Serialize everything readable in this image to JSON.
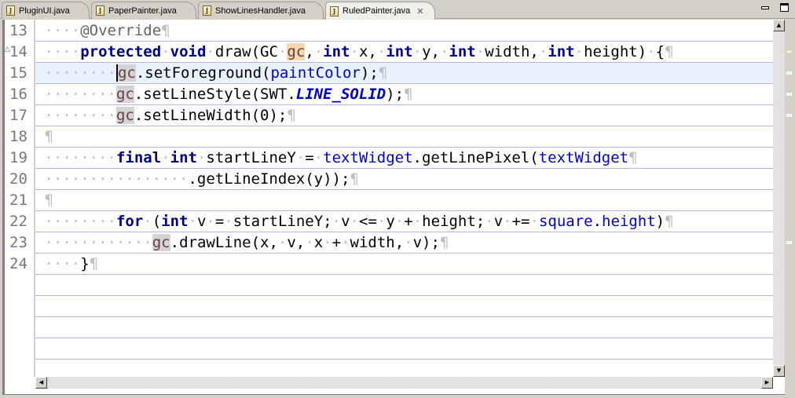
{
  "tabs": [
    {
      "label": "PluginUI.java",
      "active": false
    },
    {
      "label": "PaperPainter.java",
      "active": false
    },
    {
      "label": "ShowLinesHandler.java",
      "active": false
    },
    {
      "label": "RuledPainter.java",
      "active": true
    }
  ],
  "tab_icon": "java-file-icon",
  "close_icon": "close-icon",
  "window_controls": {
    "minimize": "minimize-icon",
    "maximize": "maximize-icon"
  },
  "editor": {
    "current_line": 15,
    "lines": [
      {
        "num": "13",
        "text": "    @Override"
      },
      {
        "num": "14",
        "text": "    protected void draw(GC gc, int x, int y, int width, int height) {",
        "marker": "override-indicator-icon"
      },
      {
        "num": "15",
        "text": "        gc.setForeground(paintColor);"
      },
      {
        "num": "16",
        "text": "        gc.setLineStyle(SWT.LINE_SOLID);"
      },
      {
        "num": "17",
        "text": "        gc.setLineWidth(0);"
      },
      {
        "num": "18",
        "text": ""
      },
      {
        "num": "19",
        "text": "        final int startLineY = textWidget.getLinePixel(textWidget"
      },
      {
        "num": "20",
        "text": "                .getLineIndex(y));"
      },
      {
        "num": "21",
        "text": ""
      },
      {
        "num": "22",
        "text": "        for (int v = startLineY; v <= y + height; v += square.height)"
      },
      {
        "num": "23",
        "text": "            gc.drawLine(x, v, x + width, v);"
      },
      {
        "num": "24",
        "text": "    }"
      }
    ]
  },
  "scrollbars": {
    "up": "▲",
    "down": "▼",
    "left": "◀",
    "right": "▶"
  },
  "colors": {
    "keyword": "#00007f",
    "field": "#0000c0",
    "annotation": "#646464",
    "current_line": "#e8f2fe",
    "rule_line": "#b8b8dc"
  }
}
